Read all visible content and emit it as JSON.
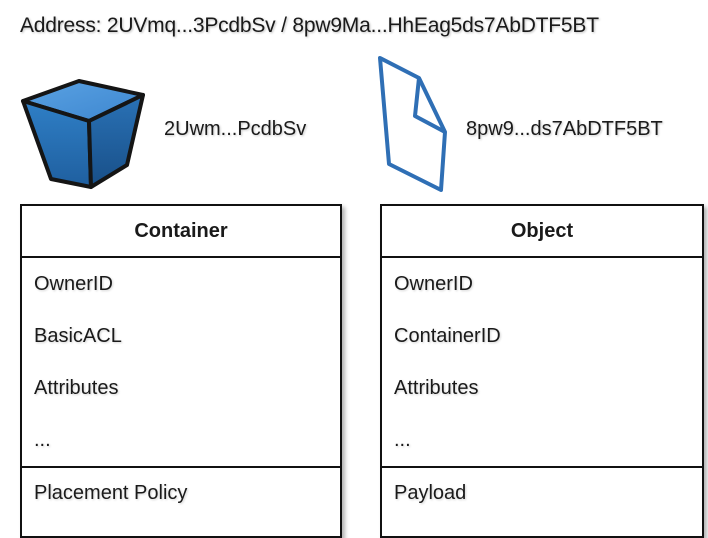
{
  "header": {
    "address": "Address: 2UVmq...3PcdbSv / 8pw9Ma...HhEag5ds7AbDTF5BT"
  },
  "container_icon": {
    "label": "2Uwm...PcdbSv",
    "icon": "cube-icon",
    "color": "#2f7fc6"
  },
  "object_icon": {
    "label": "8pw9...ds7AbDTF5BT",
    "icon": "document-icon",
    "color": "#2f7fc6"
  },
  "container_box": {
    "title": "Container",
    "fields": [
      "OwnerID",
      "BasicACL",
      "Attributes",
      "..."
    ],
    "footer": "Placement Policy"
  },
  "object_box": {
    "title": "Object",
    "fields": [
      "OwnerID",
      "ContainerID",
      "Attributes",
      "..."
    ],
    "footer": "Payload"
  }
}
